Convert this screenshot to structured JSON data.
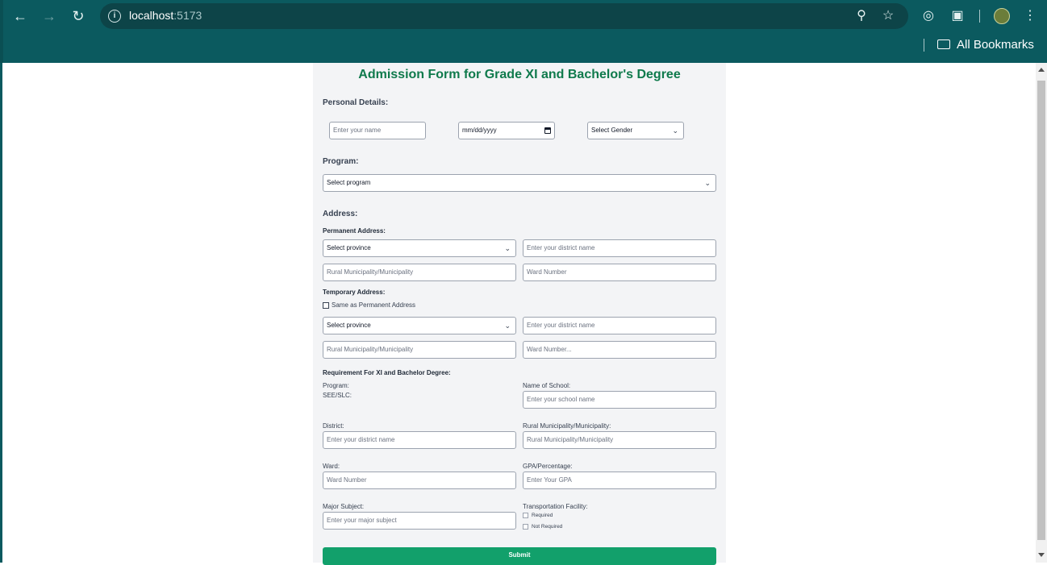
{
  "browser": {
    "url_host": "localhost",
    "url_port": ":5173",
    "bookmarks_label": "All Bookmarks"
  },
  "form": {
    "title": "Admission Form for Grade XI and Bachelor's Degree",
    "personal": {
      "heading": "Personal Details:",
      "name_placeholder": "Enter your name",
      "dob_value": "mm/dd/yyyy",
      "gender_value": "Select Gender"
    },
    "program": {
      "heading": "Program:",
      "value": "Select program"
    },
    "address": {
      "heading": "Address:",
      "permanent": {
        "heading": "Permanent Address:",
        "province_value": "Select province",
        "district_placeholder": "Enter your district name",
        "municipality_placeholder": "Rural Municipality/Municipality",
        "ward_placeholder": "Ward Number"
      },
      "temporary": {
        "heading": "Temporary Address:",
        "same_label": "Same as Permanent Address",
        "province_value": "Select province",
        "district_placeholder": "Enter your district name",
        "municipality_placeholder": "Rural Municipality/Municipality",
        "ward_placeholder": "Ward Number..."
      }
    },
    "requirement": {
      "heading": "Requirement For XI and Bachelor Degree:",
      "program_label": "Program:",
      "program_value": "SEE/SLC:",
      "school_label": "Name of School:",
      "school_placeholder": "Enter your school name",
      "district_label": "District:",
      "district_placeholder": "Enter your district name",
      "municipality_label": "Rural Municipality/Municipality:",
      "municipality_placeholder": "Rural Municipality/Municipality",
      "ward_label": "Ward:",
      "ward_placeholder": "Ward Number",
      "gpa_label": "GPA/Percentage:",
      "gpa_placeholder": "Enter Your GPA",
      "major_label": "Major Subject:",
      "major_placeholder": "Enter your major subject",
      "transport_label": "Transportation Facility:",
      "transport_options": [
        "Required",
        "Not Required"
      ]
    },
    "submit_label": "Submit"
  },
  "colors": {
    "chrome": "#0b5a5f",
    "title": "#0f7a4c",
    "submit": "#12a06b"
  }
}
